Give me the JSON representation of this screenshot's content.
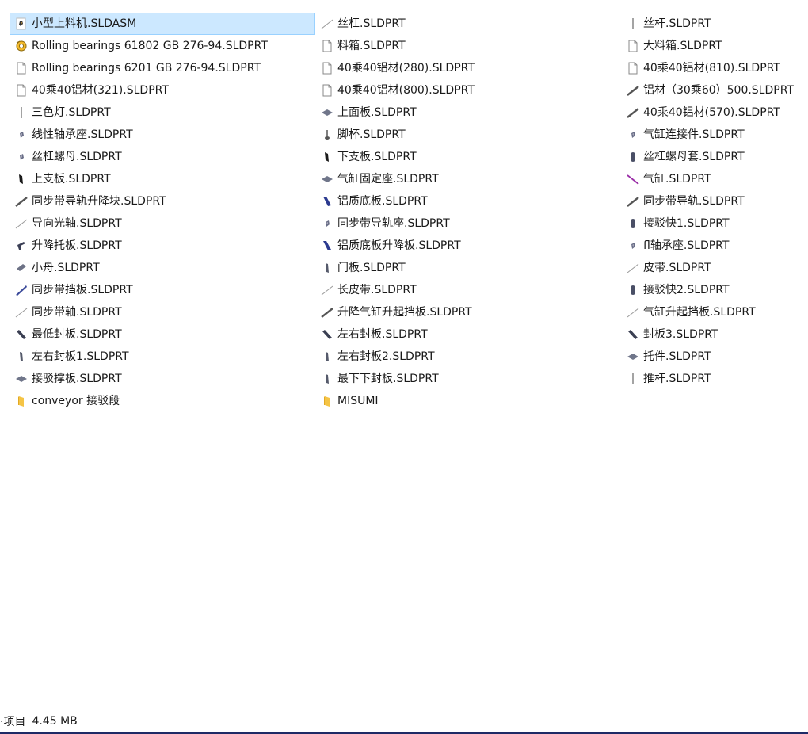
{
  "columns": [
    [
      {
        "name": "小型上料机.SLDASM",
        "icon": "assembly-icon",
        "selected": true
      },
      {
        "name": "Rolling bearings 61802 GB 276-94.SLDPRT",
        "icon": "bearing-icon"
      },
      {
        "name": "Rolling bearings 6201 GB 276-94.SLDPRT",
        "icon": "blank-file-icon"
      },
      {
        "name": "40乘40铝材(321).SLDPRT",
        "icon": "blank-file-icon"
      },
      {
        "name": "三色灯.SLDPRT",
        "icon": "thin-rod-icon"
      },
      {
        "name": "线性轴承座.SLDPRT",
        "icon": "small-part-icon"
      },
      {
        "name": "丝杠螺母.SLDPRT",
        "icon": "small-part-icon"
      },
      {
        "name": "上支板.SLDPRT",
        "icon": "dark-plate-icon"
      },
      {
        "name": "同步带导轨升降块.SLDPRT",
        "icon": "diagonal-bar-icon"
      },
      {
        "name": "导向光轴.SLDPRT",
        "icon": "thin-diagonal-icon"
      },
      {
        "name": "升降托板.SLDPRT",
        "icon": "bracket-icon"
      },
      {
        "name": "小舟.SLDPRT",
        "icon": "tilted-block-icon"
      },
      {
        "name": "同步带挡板.SLDPRT",
        "icon": "blue-diagonal-icon"
      },
      {
        "name": "同步带轴.SLDPRT",
        "icon": "thin-diagonal-icon"
      },
      {
        "name": "最低封板.SLDPRT",
        "icon": "slanted-plate-icon"
      },
      {
        "name": "左右封板1.SLDPRT",
        "icon": "vertical-plate-icon"
      },
      {
        "name": "接驳撑板.SLDPRT",
        "icon": "flat-plate-icon"
      },
      {
        "name": "conveyor 接驳段",
        "icon": "folder-icon"
      }
    ],
    [
      {
        "name": "丝杠.SLDPRT",
        "icon": "thin-diagonal-icon"
      },
      {
        "name": "料箱.SLDPRT",
        "icon": "blank-file-icon"
      },
      {
        "name": "40乘40铝材(280).SLDPRT",
        "icon": "blank-file-icon"
      },
      {
        "name": "40乘40铝材(800).SLDPRT",
        "icon": "blank-file-icon"
      },
      {
        "name": "上面板.SLDPRT",
        "icon": "flat-plate-icon"
      },
      {
        "name": "脚杯.SLDPRT",
        "icon": "foot-cup-icon"
      },
      {
        "name": "下支板.SLDPRT",
        "icon": "dark-plate-icon"
      },
      {
        "name": "气缸固定座.SLDPRT",
        "icon": "flat-plate-icon"
      },
      {
        "name": "铝质底板.SLDPRT",
        "icon": "blue-slab-icon"
      },
      {
        "name": "同步带导轨座.SLDPRT",
        "icon": "small-part-icon"
      },
      {
        "name": "铝质底板升降板.SLDPRT",
        "icon": "blue-slab-icon"
      },
      {
        "name": "门板.SLDPRT",
        "icon": "vertical-plate-icon"
      },
      {
        "name": "长皮带.SLDPRT",
        "icon": "thin-diagonal-icon"
      },
      {
        "name": "升降气缸升起挡板.SLDPRT",
        "icon": "diagonal-bar-icon"
      },
      {
        "name": "左右封板.SLDPRT",
        "icon": "slanted-plate-icon"
      },
      {
        "name": "左右封板2.SLDPRT",
        "icon": "vertical-plate-icon"
      },
      {
        "name": "最下下封板.SLDPRT",
        "icon": "vertical-plate-icon"
      },
      {
        "name": "MISUMI",
        "icon": "folder-icon"
      }
    ],
    [
      {
        "name": "丝杆.SLDPRT",
        "icon": "thin-rod-icon"
      },
      {
        "name": "大料箱.SLDPRT",
        "icon": "blank-file-icon"
      },
      {
        "name": "40乘40铝材(810).SLDPRT",
        "icon": "blank-file-icon"
      },
      {
        "name": "铝材（30乘60）500.SLDPRT",
        "icon": "diagonal-bar-icon"
      },
      {
        "name": "40乘40铝材(570).SLDPRT",
        "icon": "diagonal-bar-icon"
      },
      {
        "name": "气缸连接件.SLDPRT",
        "icon": "small-part-icon"
      },
      {
        "name": "丝杠螺母套.SLDPRT",
        "icon": "cylinder-icon"
      },
      {
        "name": "气缸.SLDPRT",
        "icon": "purple-rod-icon"
      },
      {
        "name": "同步带导轨.SLDPRT",
        "icon": "diagonal-bar-icon"
      },
      {
        "name": "接驳快1.SLDPRT",
        "icon": "cylinder-icon"
      },
      {
        "name": "fl轴承座.SLDPRT",
        "icon": "small-part-icon"
      },
      {
        "name": "皮带.SLDPRT",
        "icon": "thin-diagonal-icon"
      },
      {
        "name": "接驳快2.SLDPRT",
        "icon": "cylinder-icon"
      },
      {
        "name": "气缸升起挡板.SLDPRT",
        "icon": "thin-diagonal-icon"
      },
      {
        "name": "封板3.SLDPRT",
        "icon": "slanted-plate-icon"
      },
      {
        "name": "托件.SLDPRT",
        "icon": "flat-plate-icon"
      },
      {
        "name": "推杆.SLDPRT",
        "icon": "thin-rod-icon"
      }
    ]
  ],
  "status": {
    "count": "·项目",
    "size": "4.45 MB"
  },
  "colors": {
    "selection_bg": "#cce8ff",
    "selection_border": "#99d1ff",
    "folder": "#f5c445",
    "bottom_border": "#1e2a66"
  }
}
